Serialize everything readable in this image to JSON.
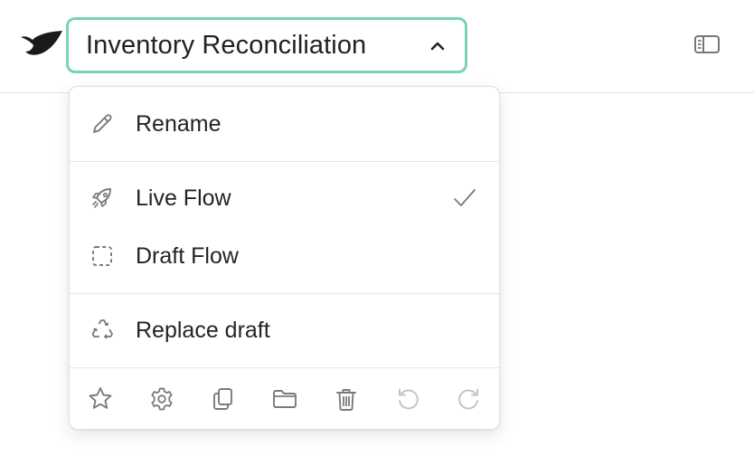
{
  "header": {
    "flow_title": "Inventory Reconciliation",
    "logo_icon": "brand-logo",
    "panel_icon": "sidebar-panel-icon"
  },
  "menu": {
    "rename_label": "Rename",
    "live_flow_label": "Live Flow",
    "draft_flow_label": "Draft Flow",
    "replace_draft_label": "Replace draft",
    "selected": "Live Flow"
  },
  "toolbar": {
    "icons": [
      "star-icon",
      "gear-icon",
      "copy-icon",
      "folder-icon",
      "trash-icon",
      "undo-icon",
      "redo-icon"
    ]
  },
  "colors": {
    "accent_border": "#78d3b4",
    "icon_gray": "#7a7a7a",
    "disabled_gray": "#c4c4c4"
  }
}
